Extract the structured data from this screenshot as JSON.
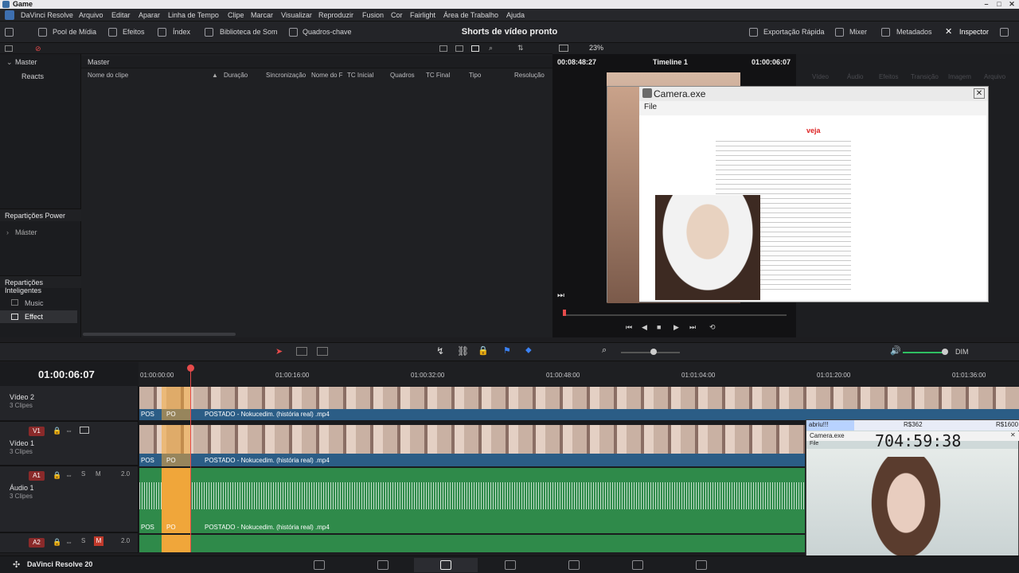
{
  "window": {
    "title": "Game"
  },
  "menu": [
    "DaVinci Resolve",
    "Arquivo",
    "Editar",
    "Aparar",
    "Linha de Tempo",
    "Clipe",
    "Marcar",
    "Visualizar",
    "Reproduzir",
    "Fusion",
    "Cor",
    "Fairlight",
    "Área de Trabalho",
    "Ajuda"
  ],
  "toolbar": {
    "media_pool": "Pool de Mídia",
    "effects": "Efeitos",
    "index": "Índex",
    "sound_library": "Biblioteca de Som",
    "keyframes": "Quadros-chave",
    "project_title": "Shorts de vídeo pronto",
    "quick_export": "Exportação Rápida",
    "mixer": "Mixer",
    "metadata": "Metadados",
    "inspector": "Inspector"
  },
  "left_panel": {
    "master": "Master",
    "reacts": "Reacts",
    "power_bins": "Repartições Power",
    "power_master": "Máster",
    "smart_bins": "Repartições Inteligentes",
    "smart_items": [
      "Music",
      "Effect"
    ]
  },
  "media_pool": {
    "bin_label": "Master",
    "columns": [
      "Nome do clipe",
      "Duração",
      "Sincronização",
      "Nome do F",
      "TC Inicial",
      "Quadros",
      "TC Final",
      "Tipo",
      "Resolução"
    ]
  },
  "viewer": {
    "zoom": "23%",
    "source_tc": "00:08:48:27",
    "timeline_name": "Timeline 1",
    "record_tc": "01:00:06:07"
  },
  "inspector_tabs": [
    "Vídeo",
    "Áudio",
    "Efeitos",
    "Transição",
    "Imagem",
    "Arquivo"
  ],
  "camera_window": {
    "title": "Camera.exe",
    "menu_file": "File",
    "site": "veja"
  },
  "timeline": {
    "timecode": "01:00:06:07",
    "ruler": [
      "01:00:00:00",
      "01:00:16:00",
      "01:00:32:00",
      "01:00:48:00",
      "01:01:04:00",
      "01:01:20:00",
      "01:01:36:00"
    ],
    "dim_label": "DIM",
    "tracks": [
      {
        "id": "",
        "name": "Vídeo 2",
        "clips": "3 Clipes",
        "clip_label": "POSTADO - Nokucedim. (história real) .mp4",
        "short1": "POS",
        "short2": "PO"
      },
      {
        "id": "V1",
        "name": "Vídeo 1",
        "clips": "3 Clipes",
        "clip_label": "POSTADO - Nokucedim. (história real) .mp4",
        "short1": "POS",
        "short2": "PO"
      },
      {
        "id": "A1",
        "name": "Áudio 1",
        "clips": "3 Clipes",
        "clip_label": "POSTADO - Nokucedim. (história real) .mp4",
        "short1": "POS",
        "short2": "PO",
        "level": "2.0"
      },
      {
        "id": "A2",
        "name": "",
        "clips": "",
        "level": "2.0"
      }
    ]
  },
  "webcam": {
    "tag": "abriu!!!",
    "amount1": "R$362",
    "amount2": "R$1600",
    "title": "Camera.exe",
    "menu": "File",
    "clock": "704:59:38"
  },
  "statusbar": {
    "app": "DaVinci Resolve 20"
  },
  "colors": {
    "accent_red": "#e64b4b",
    "clip_blue": "#2b5d86",
    "audio_green": "#2f8a4a",
    "clip_orange": "#f0a63a"
  }
}
